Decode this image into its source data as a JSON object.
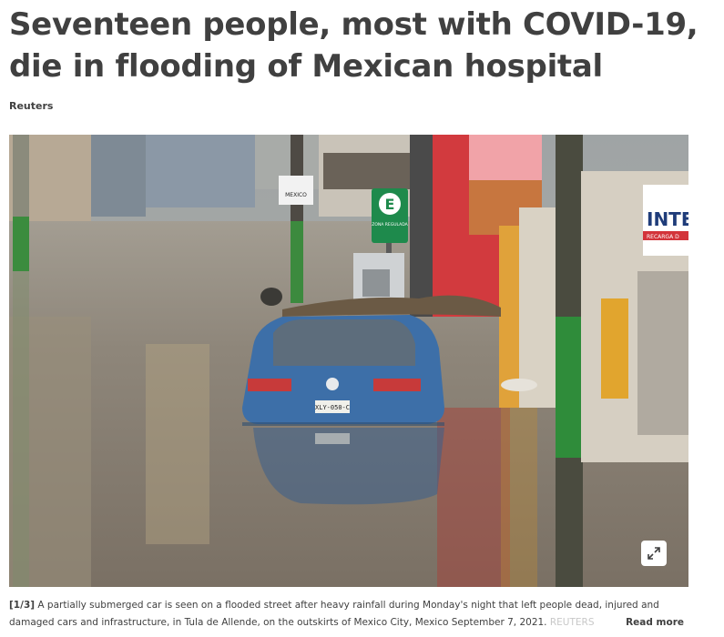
{
  "article": {
    "headline": "Seventeen people, most with COVID-19, die in flooding of Mexican hospital",
    "byline": "Reuters"
  },
  "photo": {
    "counter": "[1/3]",
    "caption": "A partially submerged car is seen on a flooded street after heavy rainfall during Monday's night that left people dead, injured and damaged cars and infrastructure, in Tula de Allende, on the outskirts of Mexico City, Mexico September 7, 2021.",
    "credit": "REUTERS",
    "read_more": "Read more",
    "expand_icon": "expand-icon",
    "signs": {
      "parking_letter": "E",
      "parking_sub": "ZONA REGULADA",
      "store_sign": "INTE",
      "store_sub": "RECARGA D",
      "street_sign": "MEXICO",
      "plate": "XLY-050-C"
    }
  },
  "colors": {
    "text": "#404040",
    "water": "#8c8274",
    "car": "#3d6fa8"
  }
}
